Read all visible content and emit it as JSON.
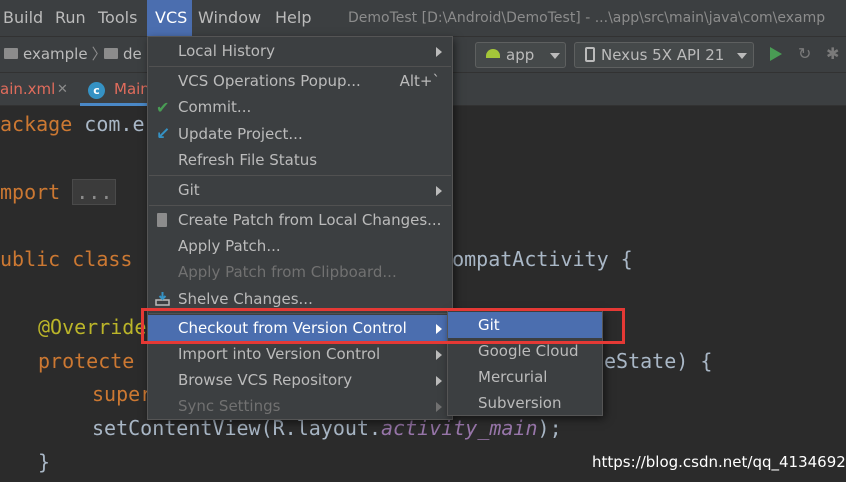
{
  "menubar": {
    "items": [
      {
        "label": "Build",
        "mnemonic": "B"
      },
      {
        "label": "Run",
        "mnemonic": "R"
      },
      {
        "label": "Tools",
        "mnemonic": "T"
      },
      {
        "label": "VCS",
        "mnemonic": "S"
      },
      {
        "label": "Window",
        "mnemonic": "W"
      },
      {
        "label": "Help",
        "mnemonic": "H"
      }
    ],
    "window_title": "DemoTest [D:\\Android\\DemoTest] - ...\\app\\src\\main\\java\\com\\examp"
  },
  "navbar": {
    "crumb1": "example",
    "crumb2": "de",
    "run_config": "app",
    "device": "Nexus 5X API 21"
  },
  "tabs": {
    "tab1": "ain.xml",
    "tab1_close": "✕",
    "tab2": "Main",
    "tab2_icon_letter": "c"
  },
  "code": {
    "l1_kw": "ackage",
    "l1_rest": " com.e",
    "l2_kw": "mport",
    "l2_fold": "...",
    "l3_kw": "ublic class",
    "l3_tail": "pCompatActivity {",
    "l4_ann": "@Override",
    "l5_kw": "protecte",
    "l5_tail": "eState) {",
    "l6_kw": "super",
    "l7_a": "setContentView(R.layout.",
    "l7_field": "activity_main",
    "l7_b": ");",
    "l8": "}"
  },
  "vcs_menu": {
    "items": [
      {
        "label": "Local History",
        "mnemonic": "H",
        "submenu": true
      },
      {
        "label": "VCS Operations Popup...",
        "shortcut": "Alt+`"
      },
      {
        "label": "Commit...",
        "mnemonic": "i",
        "icon": "check-icon"
      },
      {
        "label": "Update Project...",
        "mnemonic": "U",
        "icon": "update-icon"
      },
      {
        "label": "Refresh File Status",
        "mnemonic": "e"
      },
      {
        "label": "Git",
        "mnemonic": "G",
        "submenu": true
      },
      {
        "label": "Create Patch from Local Changes...",
        "icon": "patch-icon"
      },
      {
        "label": "Apply Patch..."
      },
      {
        "label": "Apply Patch from Clipboard...",
        "disabled": true
      },
      {
        "label": "Shelve Changes...",
        "icon": "shelve-icon"
      },
      {
        "label": "Checkout from Version Control",
        "mnemonic": "o",
        "submenu": true,
        "selected": true
      },
      {
        "label": "Import into Version Control",
        "submenu": true
      },
      {
        "label": "Browse VCS Repository",
        "submenu": true
      },
      {
        "label": "Sync Settings",
        "submenu": true,
        "disabled": true
      }
    ]
  },
  "checkout_submenu": {
    "items": [
      {
        "label": "Git",
        "mnemonic": "G",
        "selected": true
      },
      {
        "label": "Google Cloud",
        "mnemonic": "G"
      },
      {
        "label": "Mercurial",
        "mnemonic": "M"
      },
      {
        "label": "Subversion",
        "mnemonic": "S"
      }
    ]
  },
  "watermark": "https://blog.csdn.net/qq_41346925",
  "colors": {
    "accent": "#4b6eaf",
    "highlight_box": "#e53935",
    "menu_bg": "#3c3f41",
    "editor_bg": "#2b2b2b"
  }
}
